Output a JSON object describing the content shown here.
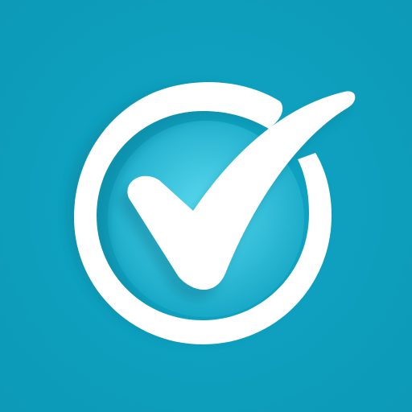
{
  "icon": {
    "name": "checkmark-circle-icon",
    "colors": {
      "background": "#0fa6c4",
      "background_edge": "#0c9ab8",
      "inner_glow_center": "#5ad9ef",
      "inner_glow_edge": "#18a9c7",
      "mark": "#ffffff",
      "shadow": "#0a7f99"
    }
  }
}
